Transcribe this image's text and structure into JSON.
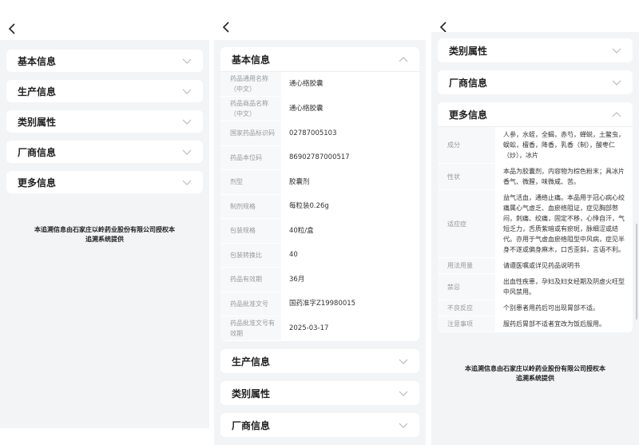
{
  "panels": {
    "p1": {
      "sections": [
        {
          "title": "基本信息"
        },
        {
          "title": "生产信息"
        },
        {
          "title": "类别属性"
        },
        {
          "title": "厂商信息"
        },
        {
          "title": "更多信息"
        }
      ],
      "trace_line1": "本追溯信息由石家庄以岭药业股份有限公司授权本",
      "trace_line2": "追溯系统提供"
    },
    "p2": {
      "basic_title": "基本信息",
      "basic_rows": [
        {
          "label": "药品通用名称（中文）",
          "value": "通心络胶囊"
        },
        {
          "label": "药品商品名称（中文）",
          "value": "通心络胶囊"
        },
        {
          "label": "国家药品标识码",
          "value": "02787005103"
        },
        {
          "label": "药品本位码",
          "value": "86902787000517"
        },
        {
          "label": "剂型",
          "value": "胶囊剂"
        },
        {
          "label": "制剂规格",
          "value": "每粒装0.26g"
        },
        {
          "label": "包装规格",
          "value": "40粒/盒"
        },
        {
          "label": "包装转换比",
          "value": "40"
        },
        {
          "label": "药品有效期",
          "value": "36月"
        },
        {
          "label": "药品批准文号",
          "value": "国药准字Z19980015"
        },
        {
          "label": "药品批准文号有效期",
          "value": "2025-03-17"
        }
      ],
      "collapsed": [
        {
          "title": "生产信息"
        },
        {
          "title": "类别属性"
        },
        {
          "title": "厂商信息"
        }
      ]
    },
    "p3": {
      "collapsed": [
        {
          "title": "类别属性"
        },
        {
          "title": "厂商信息"
        }
      ],
      "more_title": "更多信息",
      "more_rows": [
        {
          "label": "成分",
          "value": "人参，水蛭，全蝎，赤芍，蝉蜕，土鳖虫，蜈蚣，檀香，降香，乳香（制），酸枣仁（炒），冰片"
        },
        {
          "label": "性状",
          "value": "本品为胶囊剂，内容物为棕色粉末；具冰片香气、微腥，味微咸、苦。"
        },
        {
          "label": "适应症",
          "value": "益气活血，通络止痛。本品用于冠心病心绞痛属心气虚乏、血瘀络阻证，症见胸部憋闷，刺痛、绞痛，固定不移，心悸自汗，气短乏力，舌质紫暗或有瘀斑，脉细涩或结代。亦用于气虚血瘀络阻型中风病，症见半身不遂或偏身麻木，口舌歪斜，言语不利。"
        },
        {
          "label": "用法用量",
          "value": "请遵医嘱或详见药品说明书"
        },
        {
          "label": "禁忌",
          "value": "出血性疾患，孕妇及妇女经期及阴虚火旺型中风禁用。"
        },
        {
          "label": "不良反应",
          "value": "个别患者用药后可出现胃部不适。"
        },
        {
          "label": "注意事项",
          "value": "服药后胃部不适者宜改为饭后服用。"
        }
      ],
      "trace_line1": "本追溯信息由石家庄以岭药业股份有限公司授权本",
      "trace_line2": "追溯系统提供"
    }
  }
}
